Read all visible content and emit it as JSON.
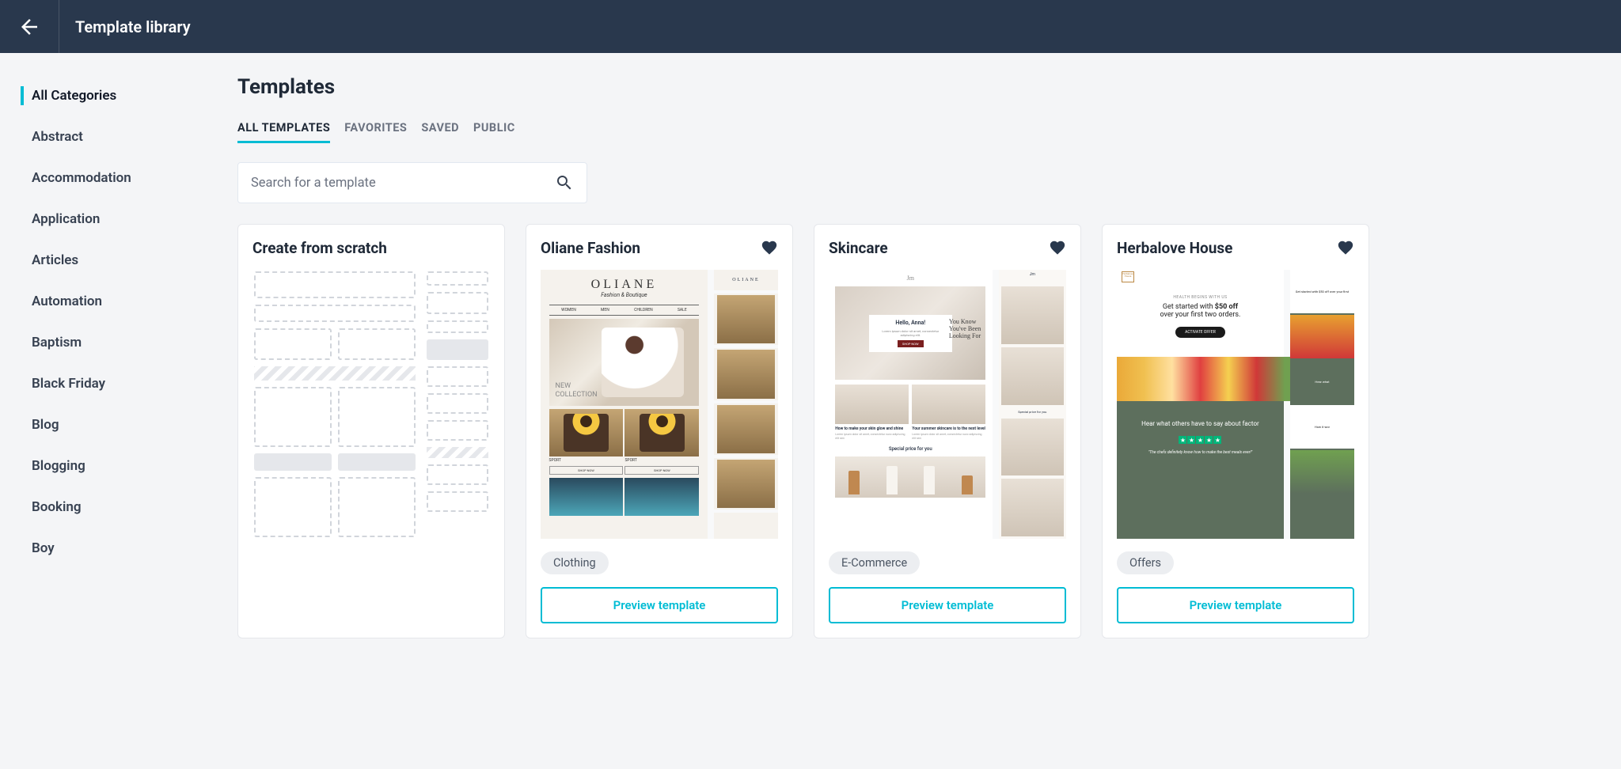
{
  "header": {
    "title": "Template library"
  },
  "sidebar": {
    "categories": [
      "All Categories",
      "Abstract",
      "Accommodation",
      "Application",
      "Articles",
      "Automation",
      "Baptism",
      "Black Friday",
      "Blog",
      "Blogging",
      "Booking",
      "Boy"
    ],
    "active_index": 0
  },
  "main": {
    "title": "Templates",
    "tabs": [
      "ALL TEMPLATES",
      "FAVORITES",
      "SAVED",
      "PUBLIC"
    ],
    "active_tab_index": 0,
    "search_placeholder": "Search for a template"
  },
  "cards": [
    {
      "title": "Create from scratch",
      "has_favorite": false,
      "has_category": false,
      "has_preview_btn": false
    },
    {
      "title": "Oliane Fashion",
      "has_favorite": true,
      "category": "Clothing",
      "preview_btn": "Preview template",
      "preview": {
        "logo": "OLIANE",
        "sub": "Fashion & Boutique",
        "nav": [
          "WOMEN",
          "MEN",
          "CHILDREN",
          "SALE"
        ],
        "hero_text": "NEW\nCOLLECTION",
        "label": "SPORT",
        "shop_btn": "SHOP NOW"
      }
    },
    {
      "title": "Skincare",
      "has_favorite": true,
      "category": "E-Commerce",
      "preview_btn": "Preview template",
      "preview": {
        "hello": "Hello, Anna!",
        "lorem": "Lorem ipsum dolor sit amet, consectetur adipiscing elit.",
        "shop_btn": "SHOP NOW",
        "hero_side": "You Know You've Been Looking For",
        "col1_h": "How to make your skin glow and shine",
        "col2_h": "Your summer skincare is to the next level",
        "col_p": "Lorem ipsum dolor sit amet, consectetur nunc adipiscing elit sed.",
        "price": "Special price for you"
      }
    },
    {
      "title": "Herbalove House",
      "has_favorite": true,
      "category": "Offers",
      "preview_btn": "Preview template",
      "preview": {
        "tag": "HEALTH BEGINS WITH US",
        "offer": "Get started with $50 off over your first two orders.",
        "activate": "ACTIVATE OFFER",
        "hear": "Hear what others have to say about factor",
        "quote": "\"The chefs definitely know how to make the best meals ever!\"",
        "side1": "Get started with $50 off over your first",
        "side2": "Hear what",
        "side3": "How it wor"
      }
    }
  ]
}
